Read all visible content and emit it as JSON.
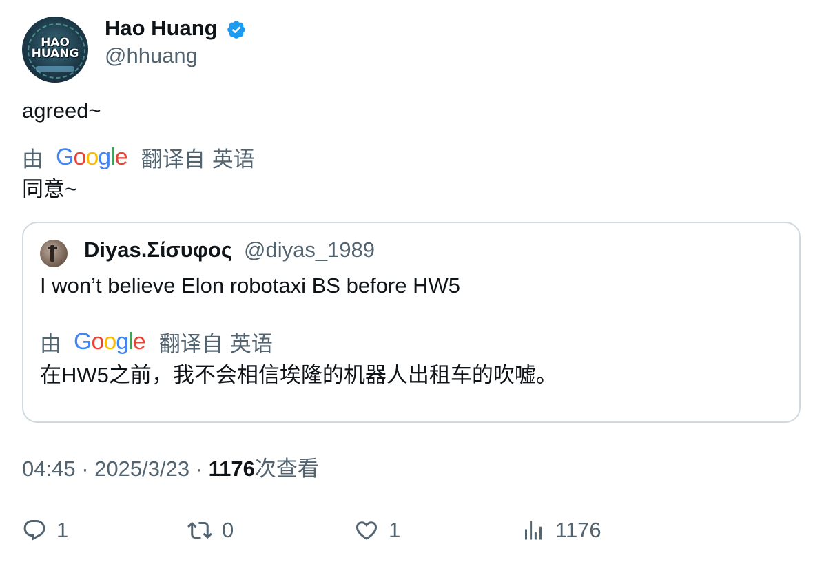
{
  "author": {
    "name": "Hao Huang",
    "handle": "@hhuang",
    "avatar_text_line1": "HAO",
    "avatar_text_line2": "HUANG",
    "verified": true
  },
  "tweet": {
    "text": "agreed~",
    "translation": {
      "by_label": "由",
      "provider": "Google",
      "from_label": "翻译自",
      "language": "英语",
      "translated_text": "同意~"
    }
  },
  "quoted_tweet": {
    "author_name": "Diyas.Σίσυφος",
    "author_handle": "@diyas_1989",
    "text": "I won’t believe Elon robotaxi BS before HW5",
    "translation": {
      "by_label": "由",
      "provider": "Google",
      "from_label": "翻译自",
      "language": "英语",
      "translated_text": "在HW5之前，我不会相信埃隆的机器人出租车的吹嘘。"
    }
  },
  "meta": {
    "time": "04:45",
    "separator": "·",
    "date": "2025/3/23",
    "views_count": "1176",
    "views_label": "次查看"
  },
  "actions": {
    "reply_count": "1",
    "retweet_count": "0",
    "like_count": "1",
    "views_count": "1176"
  },
  "colors": {
    "verified": "#1d9bf0",
    "secondary_text": "#536471",
    "border": "#cfd9de"
  }
}
